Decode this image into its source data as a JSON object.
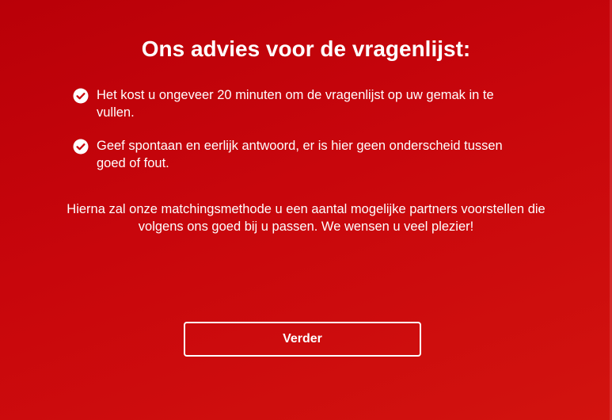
{
  "title": "Ons advies voor de vragenlijst:",
  "advice": {
    "icon": "check-circle-icon",
    "items": [
      {
        "text": "Het kost u ongeveer 20 minuten om de vragenlijst op uw gemak in te vullen."
      },
      {
        "text": "Geef spontaan en eerlijk antwoord, er is hier geen onderscheid tussen goed of fout."
      }
    ]
  },
  "outro": "Hierna zal onze matchingsmethode u een aantal mogelijke partners voorstellen die volgens ons goed bij u passen. We wensen u veel plezier!",
  "button": {
    "label": "Verder"
  },
  "colors": {
    "background": "#c8060c",
    "text": "#ffffff",
    "check_mark": "#c8060c"
  }
}
